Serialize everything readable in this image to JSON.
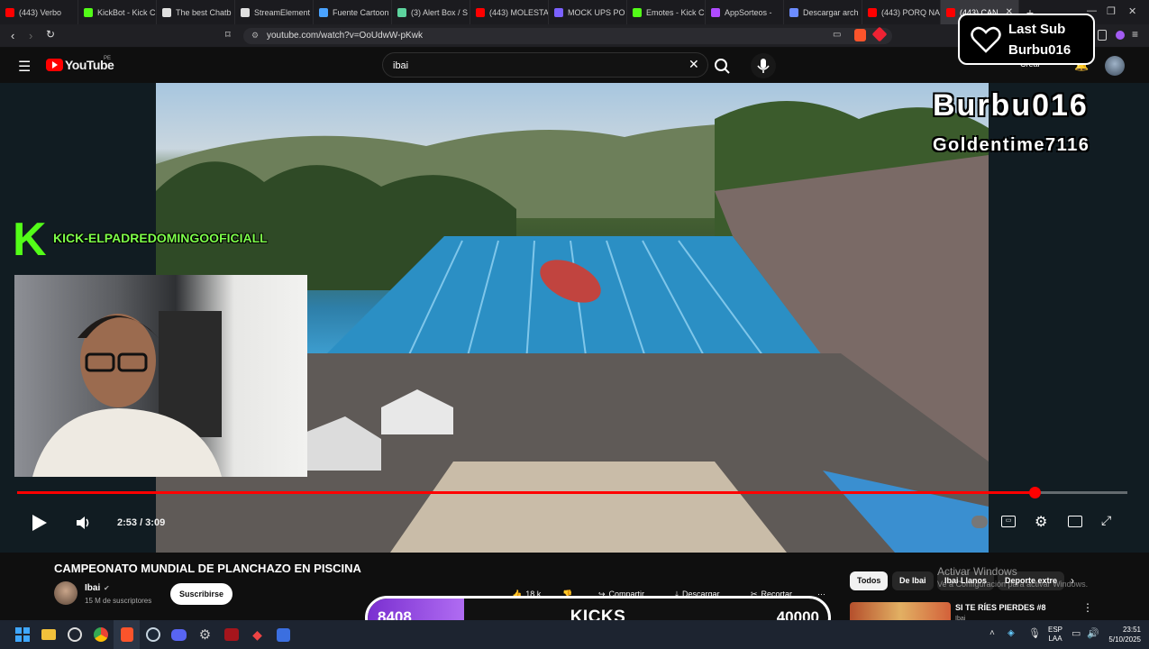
{
  "browser": {
    "tabs": [
      {
        "label": "(443) Verbo",
        "color": "#ff0000"
      },
      {
        "label": "KickBot - Kick C",
        "color": "#53fc18"
      },
      {
        "label": "The best Chatb",
        "color": "#e0e0e0"
      },
      {
        "label": "StreamElement",
        "color": "#e0e0e0"
      },
      {
        "label": "Fuente Cartoon",
        "color": "#4aa3ff"
      },
      {
        "label": "(3) Alert Box / S",
        "color": "#5dd39e"
      },
      {
        "label": "(443) MOLESTA",
        "color": "#ff0000"
      },
      {
        "label": "MOCK UPS PO",
        "color": "#7b61ff"
      },
      {
        "label": "Emotes - Kick C",
        "color": "#53fc18"
      },
      {
        "label": "AppSorteos -",
        "color": "#b04bff"
      },
      {
        "label": "Descargar arch",
        "color": "#6c8cff"
      },
      {
        "label": "(443) PORQ NA",
        "color": "#ff0000"
      },
      {
        "label": "(443) CAN",
        "color": "#ff0000"
      }
    ],
    "new_tab": "+",
    "url": "youtube.com/watch?v=OoUdwW-pKwk"
  },
  "youtube": {
    "logo_text": "YouTube",
    "region": "PE",
    "search_value": "ibai",
    "create_label": "Crear"
  },
  "video": {
    "time_current": "2:53",
    "time_total": "3:09",
    "time_display": "2:53 / 3:09",
    "progress_fraction": 0.916
  },
  "overlay": {
    "last_sub_title": "Last Sub",
    "last_sub_name": "Burbu016",
    "name_big": "Burbu016",
    "name_small": "Goldentime7116",
    "kick_letter": "K",
    "kick_channel": "KICK-ELPADREDOMINGOOFICIALL",
    "kicks_current": "8408",
    "kicks_label": "KICKS",
    "kicks_goal": "40000",
    "kicks_fraction": 0.21
  },
  "below": {
    "title": "CAMPEONATO MUNDIAL DE PLANCHAZO EN PISCINA",
    "channel": "Ibai",
    "subscribers": "15 M de suscriptores",
    "subscribe_label": "Suscribirse",
    "likes": "18 k",
    "share_label": "Compartir",
    "download_label": "Descargar",
    "clip_label": "Recortar",
    "chips": [
      "Todos",
      "De Ibai",
      "Ibai Llanos",
      "Deporte extre"
    ],
    "activate_title": "Activar Windows",
    "activate_sub": "Ve a Configuración para activar Windows.",
    "rec_title": "SI TE RÍES PIERDES #8",
    "rec_channel": "Ibai"
  },
  "taskbar": {
    "lang_top": "ESP",
    "lang_bottom": "LAA",
    "time": "23:51",
    "date": "5/10/2025"
  }
}
